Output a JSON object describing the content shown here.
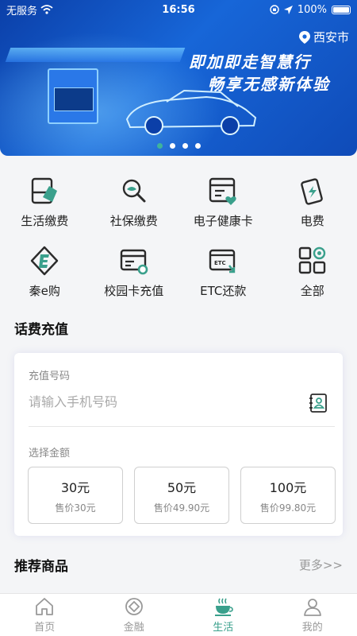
{
  "status_bar": {
    "carrier": "无服务",
    "time": "16:56",
    "battery": "100%"
  },
  "banner": {
    "city": "西安市",
    "slogan_line1": "即加即走智慧行",
    "slogan_line2": "畅享无感新体验",
    "page_count": 4,
    "active_page": 1
  },
  "services": [
    {
      "label": "生活缴费",
      "icon": "bill-icon"
    },
    {
      "label": "社保缴费",
      "icon": "magnifier-icon"
    },
    {
      "label": "电子健康卡",
      "icon": "health-card-icon"
    },
    {
      "label": "电费",
      "icon": "electricity-icon"
    },
    {
      "label": "秦e购",
      "icon": "shop-e-icon"
    },
    {
      "label": "校园卡充值",
      "icon": "campus-card-icon"
    },
    {
      "label": "ETC还款",
      "icon": "etc-card-icon"
    },
    {
      "label": "全部",
      "icon": "all-grid-icon"
    }
  ],
  "topup": {
    "title": "话费充值",
    "phone_label": "充值号码",
    "phone_placeholder": "请输入手机号码",
    "amount_label": "选择金额",
    "amounts": [
      {
        "value": "30元",
        "price": "售价30元"
      },
      {
        "value": "50元",
        "price": "售价49.90元"
      },
      {
        "value": "100元",
        "price": "售价99.80元"
      }
    ]
  },
  "recommend": {
    "title": "推荐商品",
    "more": "更多>>"
  },
  "tabbar": {
    "active": "生活",
    "tabs": [
      {
        "label": "首页",
        "icon": "home-icon"
      },
      {
        "label": "金融",
        "icon": "finance-icon"
      },
      {
        "label": "生活",
        "icon": "life-cup-icon"
      },
      {
        "label": "我的",
        "icon": "profile-icon"
      }
    ]
  },
  "colors": {
    "accent": "#3aa08c",
    "banner_blue": "#1766d8",
    "icon_dark": "#2b2b2b"
  }
}
